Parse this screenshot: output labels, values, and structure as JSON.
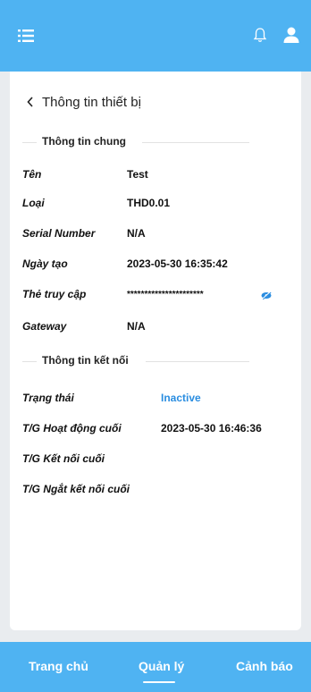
{
  "header": {
    "icons": [
      "menu-icon",
      "bell-icon",
      "user-icon"
    ],
    "bar_color": "#4fb3f2"
  },
  "page": {
    "title": "Thông tin thiết bị",
    "back_icon": "chevron-left-icon"
  },
  "general_info": {
    "section_label": "Thông tin chung",
    "fields": [
      {
        "label": "Tên",
        "value": "Test"
      },
      {
        "label": "Loại",
        "value": "THD0.01"
      },
      {
        "label": "Serial Number",
        "value": "N/A"
      },
      {
        "label": "Ngày tạo",
        "value": "2023-05-30 16:35:42"
      },
      {
        "label": "Thẻ truy cập",
        "value": "**********************",
        "icon": "eye-slash-icon"
      },
      {
        "label": "Gateway",
        "value": "N/A"
      }
    ]
  },
  "connection_info": {
    "section_label": "Thông tin kết nối",
    "fields": [
      {
        "label": "Trạng thái",
        "value": "Inactive",
        "value_color": "#2a8de0"
      },
      {
        "label": "T/G Hoạt động cuối",
        "value": "2023-05-30 16:46:36"
      },
      {
        "label": "T/G Kết nối cuối",
        "value": ""
      },
      {
        "label": "T/G Ngắt kết nối cuối",
        "value": ""
      }
    ]
  },
  "bottom_nav": {
    "items": [
      {
        "label": "Trang chủ"
      },
      {
        "label": "Quản lý",
        "active": true
      },
      {
        "label": "Cảnh báo"
      }
    ]
  }
}
